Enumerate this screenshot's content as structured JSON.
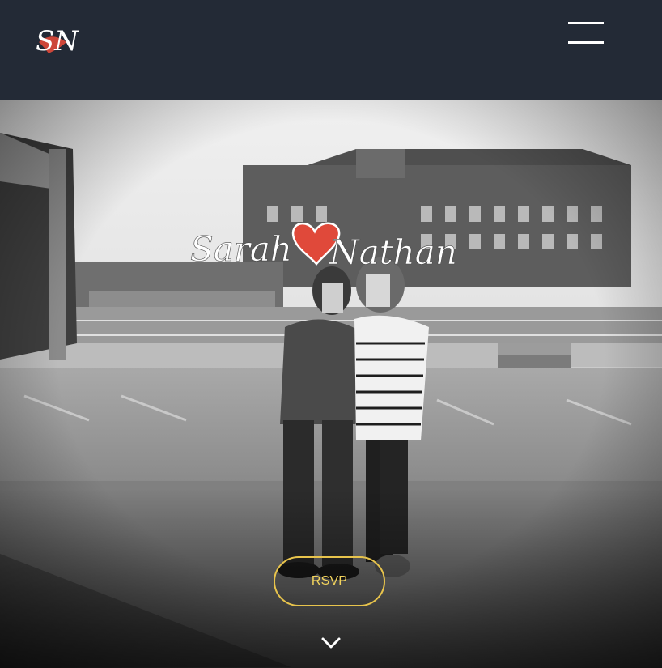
{
  "header": {
    "logo_text": "SN",
    "menu_icon": "hamburger-menu-icon"
  },
  "hero": {
    "title_first": "Sarah",
    "title_second": "Nathan",
    "heart_icon": "heart-icon",
    "rsvp_label": "RSVP",
    "scroll_icon": "chevron-down-icon"
  },
  "colors": {
    "header_bg": "#232a36",
    "accent_gold": "#e8c44c",
    "heart_red": "#e0493a",
    "text_white": "#ffffff"
  }
}
